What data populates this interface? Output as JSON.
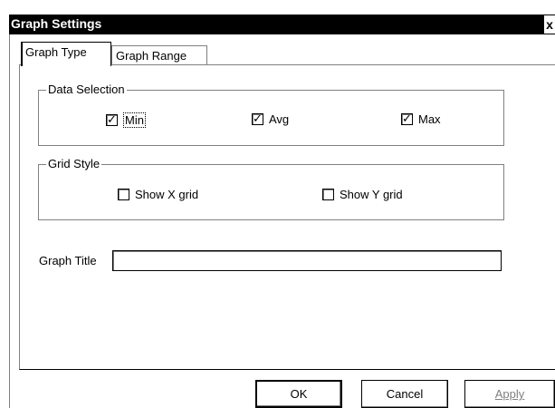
{
  "window": {
    "title": "Graph Settings",
    "close_glyph": "x"
  },
  "tabs": [
    {
      "label": "Graph Type",
      "active": true
    },
    {
      "label": "Graph Range",
      "active": false
    }
  ],
  "data_selection": {
    "legend": "Data Selection",
    "items": [
      {
        "label": "Min",
        "checked": true
      },
      {
        "label": "Avg",
        "checked": true
      },
      {
        "label": "Max",
        "checked": true
      }
    ]
  },
  "grid_style": {
    "legend": "Grid Style",
    "items": [
      {
        "label": "Show X grid",
        "checked": false
      },
      {
        "label": "Show Y grid",
        "checked": false
      }
    ]
  },
  "graph_title": {
    "label": "Graph Title",
    "value": ""
  },
  "buttons": {
    "ok": "OK",
    "cancel": "Cancel",
    "apply": "Apply"
  },
  "check_glyph": "✓"
}
